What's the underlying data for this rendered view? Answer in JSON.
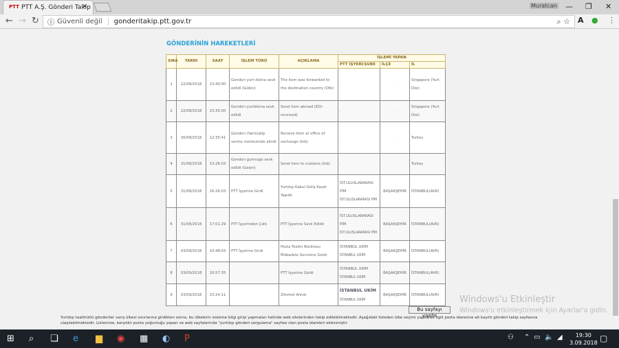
{
  "browser": {
    "tab_title": "PTT A.Ş. Gönderi Takip",
    "user": "Muratcan",
    "security": "Güvenli değil",
    "url": "gonderitakip.ptt.gov.tr"
  },
  "page": {
    "title": "GÖNDERİNİN HAREKETLERİ",
    "headers": {
      "sira": "SIRA",
      "tarih": "TARİH",
      "saat": "SAAT",
      "islem": "İŞLEM TÜRÜ",
      "aciklama": "AÇIKLAMA",
      "yapan": "İŞLEMİ YAPAN",
      "ptt": "PTT İŞYERİ/ŞUBE",
      "ilce": "İLÇE",
      "il": "İL"
    },
    "rows": [
      {
        "sira": "1",
        "tarih": "22/08/2018",
        "saat": "13:40:00",
        "islem": "Gonderi yurt disina sevk edildi (Giden)",
        "aciklama": "The item was forwarded to the destination country (Otb)",
        "ptt": ".",
        "ptt2": "",
        "ilce": ".",
        "il": "Singapore (Yurt Disi)"
      },
      {
        "sira": "2",
        "tarih": "22/08/2018",
        "saat": "23:35:00",
        "islem": "Gonderi yurtdisina sevk edildi",
        "aciklama": "Send item abroad (EDI-received)",
        "ptt": ".",
        "ptt2": "",
        "ilce": ".",
        "il": "Singapore (Yurt Disi)"
      },
      {
        "sira": "3",
        "tarih": "30/08/2018",
        "saat": "12:35:41",
        "islem": "Gonderi (Varis)alip verme merkezinde alindi",
        "aciklama": "Receive item at office of exchange (Inb)",
        "ptt": ".",
        "ptt2": "",
        "ilce": ".",
        "il": "Turkey"
      },
      {
        "sira": "4",
        "tarih": "31/08/2018",
        "saat": "13:26:03",
        "islem": "Gonderi gumruge sevk edildi (Gelen)",
        "aciklama": "Send item to customs (Inb)",
        "ptt": ".",
        "ptt2": "",
        "ilce": ".",
        "il": "Turkey"
      },
      {
        "sira": "5",
        "tarih": "31/08/2018",
        "saat": "16:26:03",
        "islem": "PTT İşyerine Girdi",
        "aciklama": "Yurtdışı Kabul Geliş Kaydı Yapıldı",
        "ptt": "İST.ULUSLARARASI PİM",
        "ptt2": "İST.ULUSLARARASI PİM",
        "ilce": "BAŞAKŞEHİR",
        "il": "İSTANBUL(AVR)"
      },
      {
        "sira": "6",
        "tarih": "31/08/2018",
        "saat": "17:01:29",
        "islem": "PTT İşyerinden Çıktı",
        "aciklama": "PTT İşyerine Sevk Edildi",
        "ptt": "İST.ULUSLARARASI PİM",
        "ptt2": "İST.ULUSLARARASI PİM",
        "ilce": "BAŞAKŞEHİR",
        "il": "İSTANBUL(AVR)"
      },
      {
        "sira": "7",
        "tarih": "03/09/2018",
        "saat": "10:48:03",
        "islem": "PTT İşyerine Girdi",
        "aciklama": "Posta Teslim Bordrosu Mübadele Servisine Geldi",
        "ptt": "İSTANBUL UKİM",
        "ptt2": "İSTANBUL UKİM",
        "ilce": "BAŞAKŞEHİR",
        "il": "İSTANBUL(AVR)"
      },
      {
        "sira": "8",
        "tarih": "03/09/2018",
        "saat": "10:57:35",
        "islem": "",
        "aciklama": "PTT İşyerine Geldi",
        "ptt": "İSTANBUL UKİM",
        "ptt2": "İSTANBUL UKİM",
        "ilce": "BAŞAKŞEHİR",
        "il": "İSTANBUL(AVR)"
      },
      {
        "sira": "9",
        "tarih": "03/09/2018",
        "saat": "15:24:11",
        "islem": "",
        "aciklama": "Zimmet Alındı",
        "ptt": "İSTANBUL UKİM",
        "ptt2": "İSTANBUL UKİM",
        "ilce": "BAŞAKŞEHİR",
        "il": "İSTANBUL(AVR)"
      }
    ],
    "print_label": "Bu sayfayı yazdır",
    "note": "Yurtdışı taahhütlü gönderiler varış ülkesi sınırlarına girdikten sonra, bu ülkelerin sisteme bilgi girişi yapmaları halinde web sitelerinden takip edilebilmektedir. Aşağıdaki listeden ülke seçimi yapılarak ilgili posta idaresine ait kayıtlı gönderi takip sayfasına ulaşılabilmektedir. Listemize, karşılıklı posta yoğunluğu yapan ve web sayfalarında \"yurtdışı gönderi sorgulama\" sayfası olan posta idareleri eklenmiştir."
  },
  "watermark": {
    "title": "Windows'u Etkinleştir",
    "subtitle": "Windows'u etkinleştirmek için Ayarlar'a gidin."
  },
  "taskbar": {
    "time": "19:30",
    "date": "3.09.2018"
  }
}
